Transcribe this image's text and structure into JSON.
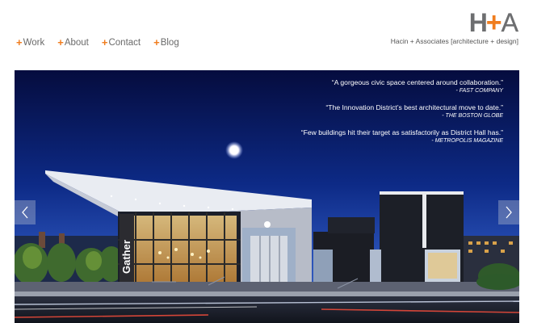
{
  "nav": {
    "items": [
      {
        "label": "Work"
      },
      {
        "label": "About"
      },
      {
        "label": "Contact"
      },
      {
        "label": "Blog"
      }
    ],
    "bullet": "+"
  },
  "logo": {
    "mark_h": "H",
    "mark_plus": "+",
    "mark_a": "A",
    "tagline": "Hacin + Associates  [architecture + design]"
  },
  "hero": {
    "building_sign": "Gather",
    "quotes": [
      {
        "text": "“A gorgeous civic space centered around collaboration.”",
        "source": "- FAST COMPANY"
      },
      {
        "text": "“The Innovation District’s best architectural move to date.”",
        "source": "- THE BOSTON GLOBE"
      },
      {
        "text": "“Few buildings hit their target as satisfactorily as District Hall has.”",
        "source": "- METROPOLIS MAGAZINE"
      }
    ]
  },
  "slider": {
    "prev_icon": "chevron-left-icon",
    "next_icon": "chevron-right-icon"
  },
  "colors": {
    "accent": "#f07d1e",
    "logo_gray": "#6d6e70",
    "sky_top": "#06104a",
    "sky_bottom": "#2a4fb0"
  }
}
